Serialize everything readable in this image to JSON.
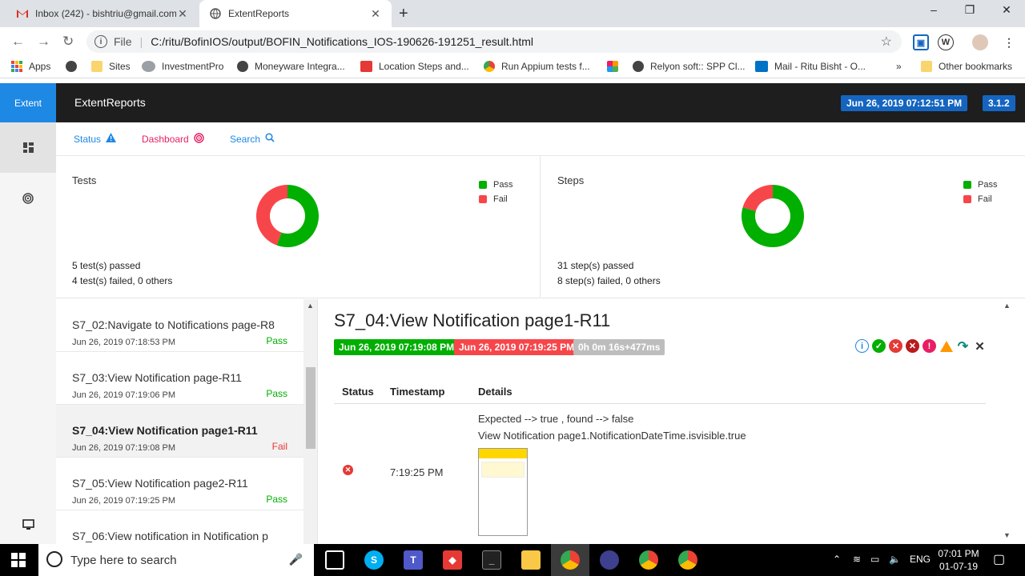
{
  "browser": {
    "tabs": [
      {
        "title": "Inbox (242) - bishtriu@gmail.com",
        "icon": "gmail-icon"
      },
      {
        "title": "ExtentReports",
        "icon": "globe-icon"
      }
    ],
    "new_tab_symbol": "+",
    "window_controls": {
      "minimize": "–",
      "maximize": "❐",
      "close": "✕"
    },
    "omnibox": {
      "scheme_label": "File",
      "url": "C:/ritu/BofinIOS/output/BOFIN_Notifications_IOS-190626-191251_result.html"
    },
    "profile_initial": "W",
    "bookmarks": [
      {
        "label": "Apps",
        "icon": "apps-grid-icon"
      },
      {
        "label": "",
        "icon": "globe-icon"
      },
      {
        "label": "Sites",
        "icon": "folder-icon"
      },
      {
        "label": "InvestmentPro",
        "icon": "cloud-icon"
      },
      {
        "label": "Moneyware Integra...",
        "icon": "globe-icon"
      },
      {
        "label": "Location Steps and...",
        "icon": "it-icon"
      },
      {
        "label": "Run Appium tests f...",
        "icon": "chrome-icon"
      },
      {
        "label": "",
        "icon": "pinwheel-icon"
      },
      {
        "label": "Relyon soft:: SPP Cl...",
        "icon": "globe-icon"
      },
      {
        "label": "Mail - Ritu Bisht - O...",
        "icon": "outlook-icon"
      }
    ],
    "bookmarks_overflow": "»",
    "other_bookmarks": "Other bookmarks"
  },
  "app": {
    "brand": "Extent",
    "title": "ExtentReports",
    "report_date": "Jun 26, 2019 07:12:51 PM",
    "version": "3.1.2",
    "subnav": [
      {
        "label": "Status",
        "icon": "warning-icon",
        "color": "#1e88e5"
      },
      {
        "label": "Dashboard",
        "icon": "target-icon",
        "color": "#e91e63"
      },
      {
        "label": "Search",
        "icon": "search-icon",
        "color": "#1e88e5"
      }
    ]
  },
  "dashboard": {
    "tests": {
      "title": "Tests",
      "legend": [
        "Pass",
        "Fail"
      ],
      "summary_line1": "5 test(s) passed",
      "summary_line2": "4 test(s) failed, 0 others"
    },
    "steps": {
      "title": "Steps",
      "legend": [
        "Pass",
        "Fail"
      ],
      "summary_line1": "31 step(s) passed",
      "summary_line2": "8 step(s) failed, 0 others"
    }
  },
  "chart_data": [
    {
      "type": "pie",
      "title": "Tests",
      "categories": [
        "Pass",
        "Fail"
      ],
      "values": [
        5,
        4
      ],
      "colors": [
        "#00af00",
        "#f7464a"
      ],
      "legend": "top-right"
    },
    {
      "type": "pie",
      "title": "Steps",
      "categories": [
        "Pass",
        "Fail"
      ],
      "values": [
        31,
        8
      ],
      "colors": [
        "#00af00",
        "#f7464a"
      ],
      "legend": "top-right"
    }
  ],
  "tests": [
    {
      "name": "S7_02:Navigate to Notifications page-R8",
      "time": "Jun 26, 2019 07:18:53 PM",
      "status": "Pass"
    },
    {
      "name": "S7_03:View Notification page-R11",
      "time": "Jun 26, 2019 07:19:06 PM",
      "status": "Pass"
    },
    {
      "name": "S7_04:View Notification page1-R11",
      "time": "Jun 26, 2019 07:19:08 PM",
      "status": "Fail"
    },
    {
      "name": "S7_05:View Notification page2-R11",
      "time": "Jun 26, 2019 07:19:25 PM",
      "status": "Pass"
    },
    {
      "name": "S7_06:View notification in Notification p",
      "time": "",
      "status": ""
    }
  ],
  "detail": {
    "title": "S7_04:View Notification page1-R11",
    "start": "Jun 26, 2019 07:19:08 PM",
    "end": "Jun 26, 2019 07:19:25 PM",
    "duration": "0h 0m 16s+477ms",
    "columns": [
      "Status",
      "Timestamp",
      "Details"
    ],
    "row": {
      "timestamp": "7:19:25 PM",
      "details_line1": "Expected --> true , found --> false",
      "details_line2": "View Notification page1.NotificationDateTime.isvisible.true"
    }
  },
  "taskbar": {
    "search_placeholder": "Type here to search",
    "language": "ENG",
    "time": "07:01 PM",
    "date": "01-07-19"
  }
}
